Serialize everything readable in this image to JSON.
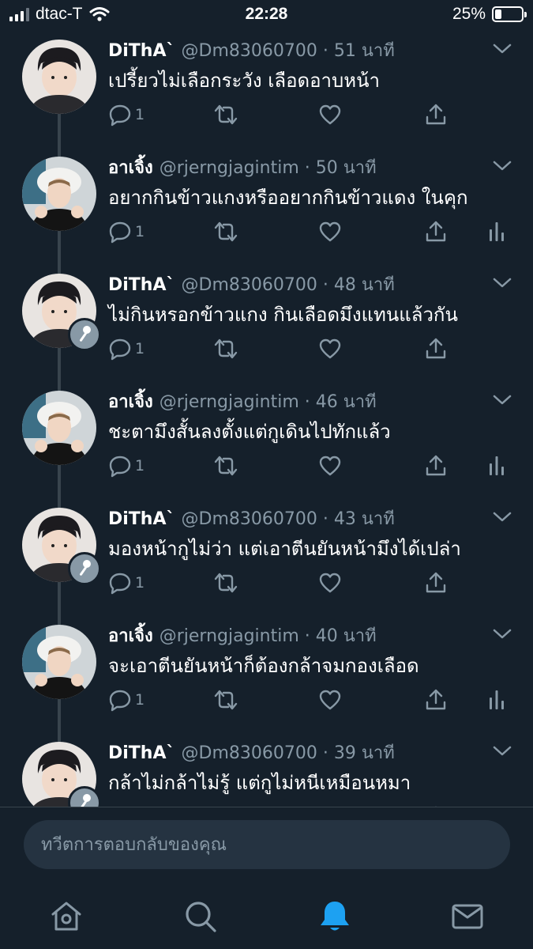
{
  "status_bar": {
    "carrier": "dtac-T",
    "time": "22:28",
    "battery": "25%",
    "battery_level": 0.25
  },
  "tweets": [
    {
      "name": "DiThA`",
      "handle": "@Dm83060700 · 51 นาที",
      "text": "เปรี้ยวไม่เลือกระวัง เลือดอาบหน้า",
      "reply_count": "1",
      "avatar": "dithA-avatar",
      "has_mic_badge": false,
      "has_stats": false
    },
    {
      "name": "อาเจิ้ง",
      "handle": "@rjerngjagintim · 50 นาที",
      "text": "อยากกินข้าวแกงหรืออยากกินข้าวแดง ในคุก",
      "reply_count": "1",
      "avatar": "arjerng-avatar",
      "has_mic_badge": false,
      "has_stats": true
    },
    {
      "name": "DiThA`",
      "handle": "@Dm83060700 · 48 นาที",
      "text": "ไม่กินหรอกข้าวแกง กินเลือดมึงแทนแล้วกัน",
      "reply_count": "1",
      "avatar": "dithA-avatar",
      "has_mic_badge": true,
      "has_stats": false
    },
    {
      "name": "อาเจิ้ง",
      "handle": "@rjerngjagintim · 46 นาที",
      "text": "ชะตามึงสั้นลงตั้งแต่กูเดินไปทักแล้ว",
      "reply_count": "1",
      "avatar": "arjerng-avatar",
      "has_mic_badge": false,
      "has_stats": true
    },
    {
      "name": "DiThA`",
      "handle": "@Dm83060700 · 43 นาที",
      "text": "มองหน้ากูไม่ว่า แต่เอาตีนยันหน้ามึงได้เปล่า",
      "reply_count": "1",
      "avatar": "dithA-avatar",
      "has_mic_badge": true,
      "has_stats": false
    },
    {
      "name": "อาเจิ้ง",
      "handle": "@rjerngjagintim · 40 นาที",
      "text": "จะเอาตีนยันหน้าก็ต้องกล้าจมกองเลือด",
      "reply_count": "1",
      "avatar": "arjerng-avatar",
      "has_mic_badge": false,
      "has_stats": true
    },
    {
      "name": "DiThA`",
      "handle": "@Dm83060700 · 39 นาที",
      "text": "กล้าไม่กล้าไม่รู้ แต่กูไม่หนีเหมือนหมา",
      "reply_count": "",
      "avatar": "dithA-avatar",
      "has_mic_badge": true,
      "has_stats": false
    }
  ],
  "composer": {
    "placeholder": "ทวีตการตอบกลับของคุณ"
  },
  "tab_bar": {
    "tabs": [
      "home-icon",
      "search-icon",
      "notifications-icon",
      "messages-icon"
    ],
    "active": "notifications-icon"
  },
  "colors": {
    "background": "#15202b",
    "secondary_text": "#8899a6",
    "accent": "#1da1f2",
    "divider": "#38444d"
  }
}
